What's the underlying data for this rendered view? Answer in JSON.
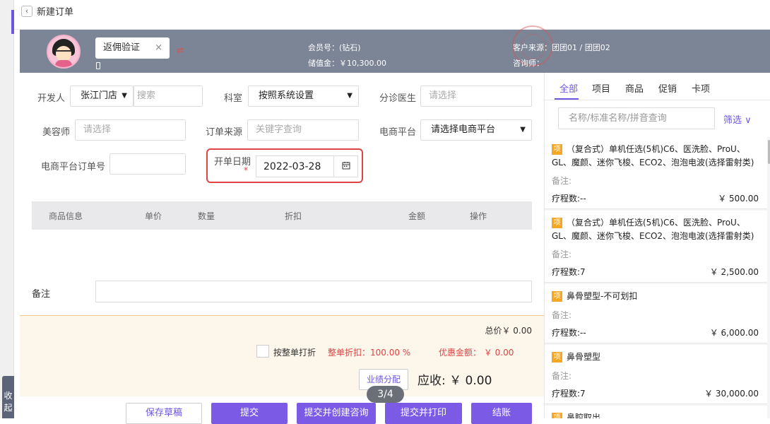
{
  "nav": {
    "back_icon": "chevron-left-icon",
    "title": "新建订单",
    "collapse_label": "收起"
  },
  "member": {
    "verify_label": "返佣验证",
    "clear_icon": "×",
    "swap_icon": "⇄",
    "member_no": "会员号：(钻石)",
    "stored_value": "储值金：￥10,300.00",
    "customer_source": "客户来源：团团01 / 团团02",
    "consultant": "咨询师："
  },
  "form": {
    "developer_label": "开发人",
    "developer_store": "张江门店",
    "developer_search_placeholder": "搜索",
    "dept_label": "科室",
    "dept_value": "按照系统设置",
    "doctor_label": "分诊医生",
    "doctor_placeholder": "请选择",
    "beautician_label": "美容师",
    "beautician_placeholder": "请选择",
    "source_label": "订单来源",
    "source_placeholder": "关键字查询",
    "platform_label": "电商平台",
    "platform_value": "请选择电商平台",
    "platform_order_label": "电商平台订单号",
    "platform_order_value": "",
    "date_label": "开单日期",
    "date_required": "*",
    "date_value": "2022-03-28",
    "calendar_icon": "📅"
  },
  "table": {
    "headers": [
      "商品信息",
      "单价",
      "数量",
      "折扣",
      "金额",
      "操作"
    ]
  },
  "remark": {
    "label": "备注",
    "value": ""
  },
  "summary": {
    "total": "总价￥ 0.00",
    "whole_discount_label": "按整单打折",
    "discount_rate": "整单折扣：100.00 %",
    "discount_amount": "优惠金额： ￥ 0.00",
    "perf_button": "业绩分配",
    "due": "应收: ￥ 0.00",
    "pager": "3/4"
  },
  "actions": {
    "save_draft": "保存草稿",
    "submit": "提交",
    "submit_consult": "提交并创建咨询",
    "submit_print": "提交并打印",
    "checkout": "结账"
  },
  "catalog": {
    "tabs": [
      "全部",
      "项目",
      "商品",
      "促销",
      "卡项"
    ],
    "active_tab": 0,
    "search_placeholder": "名称/标准名称/拼音查询",
    "filter_label": "筛选",
    "tag_label": "项",
    "note_label": "备注:",
    "items": [
      {
        "name": "（复合式）单机任选(5机)C6、医洗脸、ProU、GL、魔颜、迷你飞梭、ECO2、泡泡电波(选择雷射类)",
        "qty": "疗程数:--",
        "price": "￥ 500.00"
      },
      {
        "name": "（复合式）单机任选(5机)C6、医洗脸、ProU、GL、魔颜、迷你飞梭、ECO2、泡泡电波(选择雷射类)",
        "qty": "疗程数:7",
        "price": "￥ 2,500.00"
      },
      {
        "name": "鼻骨塑型-不可划扣",
        "qty": "疗程数:--",
        "price": "￥ 6,000.00"
      },
      {
        "name": "鼻骨塑型",
        "qty": "疗程数:7",
        "price": "￥ 30,000.00"
      },
      {
        "name": "鼻腔取出",
        "qty": "",
        "price": ""
      }
    ]
  }
}
